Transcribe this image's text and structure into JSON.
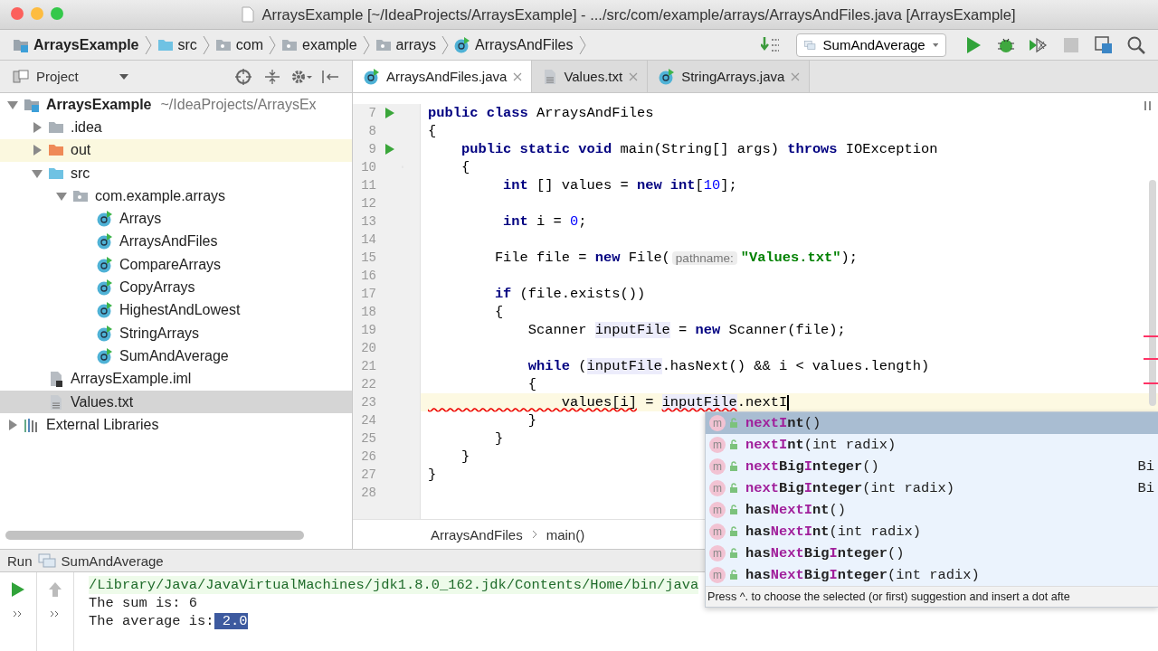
{
  "window": {
    "title": "ArraysExample [~/IdeaProjects/ArraysExample] - .../src/com/example/arrays/ArraysAndFiles.java [ArraysExample]"
  },
  "navbar": {
    "crumbs": [
      {
        "label": "ArraysExample",
        "kind": "project"
      },
      {
        "label": "src",
        "kind": "source-folder"
      },
      {
        "label": "com",
        "kind": "package"
      },
      {
        "label": "example",
        "kind": "package"
      },
      {
        "label": "arrays",
        "kind": "package"
      },
      {
        "label": "ArraysAndFiles",
        "kind": "class"
      }
    ],
    "run_config": "SumAndAverage",
    "stop_disabled": true
  },
  "project_panel": {
    "title": "Project",
    "tree": [
      {
        "label": "ArraysExample",
        "kind": "project",
        "path": "~/IdeaProjects/ArraysEx",
        "expanded": true,
        "selected": false,
        "children": [
          {
            "label": ".idea",
            "kind": "folder",
            "expanded": false,
            "selected": false
          },
          {
            "label": "out",
            "kind": "excluded-folder",
            "expanded": false,
            "selected": false
          },
          {
            "label": "src",
            "kind": "source-folder",
            "expanded": true,
            "selected": false,
            "children": [
              {
                "label": "com.example.arrays",
                "kind": "package",
                "expanded": true,
                "selected": false,
                "children": [
                  {
                    "label": "Arrays",
                    "kind": "class",
                    "selected": false
                  },
                  {
                    "label": "ArraysAndFiles",
                    "kind": "class",
                    "selected": false
                  },
                  {
                    "label": "CompareArrays",
                    "kind": "class",
                    "selected": false
                  },
                  {
                    "label": "CopyArrays",
                    "kind": "class",
                    "selected": false
                  },
                  {
                    "label": "HighestAndLowest",
                    "kind": "class",
                    "selected": false
                  },
                  {
                    "label": "StringArrays",
                    "kind": "class",
                    "selected": false
                  },
                  {
                    "label": "SumAndAverage",
                    "kind": "class",
                    "selected": false
                  }
                ]
              }
            ]
          },
          {
            "label": "ArraysExample.iml",
            "kind": "iml",
            "selected": false
          },
          {
            "label": "Values.txt",
            "kind": "text",
            "selected": true
          }
        ]
      },
      {
        "label": "External Libraries",
        "kind": "libraries",
        "expanded": false,
        "selected": false
      }
    ]
  },
  "tabs": [
    {
      "label": "ArraysAndFiles.java",
      "kind": "class",
      "selected": true
    },
    {
      "label": "Values.txt",
      "kind": "text",
      "selected": false
    },
    {
      "label": "StringArrays.java",
      "kind": "class",
      "selected": false
    }
  ],
  "editor": {
    "lines": [
      {
        "number": "7",
        "run": true,
        "tokens": [
          {
            "kind": "kw",
            "text": "public class"
          },
          {
            "kind": "plain",
            "text": " ArraysAndFiles"
          }
        ]
      },
      {
        "number": "8",
        "tokens": [
          {
            "kind": "plain",
            "text": "{"
          }
        ]
      },
      {
        "number": "9",
        "run": true,
        "tokens": [
          {
            "kind": "kw",
            "text": "    public static void"
          },
          {
            "kind": "plain",
            "text": " main(String[] args) "
          },
          {
            "kind": "kw",
            "text": "throws"
          },
          {
            "kind": "plain",
            "text": " IOException"
          }
        ]
      },
      {
        "number": "10",
        "fold": true,
        "tokens": [
          {
            "kind": "plain",
            "text": "    {"
          }
        ]
      },
      {
        "number": "11",
        "tokens": [
          {
            "kind": "kw",
            "text": "         int"
          },
          {
            "kind": "plain",
            "text": " [] values = "
          },
          {
            "kind": "kw",
            "text": "new int"
          },
          {
            "kind": "plain",
            "text": "["
          },
          {
            "kind": "num",
            "text": "10"
          },
          {
            "kind": "plain",
            "text": "];"
          }
        ]
      },
      {
        "number": "12"
      },
      {
        "number": "13",
        "tokens": [
          {
            "kind": "kw",
            "text": "         int"
          },
          {
            "kind": "plain",
            "text": " i = "
          },
          {
            "kind": "num",
            "text": "0"
          },
          {
            "kind": "plain",
            "text": ";"
          }
        ]
      },
      {
        "number": "14"
      },
      {
        "number": "15",
        "tokens": [
          {
            "kind": "plain",
            "text": "        File file = "
          },
          {
            "kind": "kw",
            "text": "new"
          },
          {
            "kind": "plain",
            "text": " File("
          },
          {
            "kind": "hint",
            "text": "pathname:"
          },
          {
            "kind": "str",
            "text": "\"Values.txt\""
          },
          {
            "kind": "plain",
            "text": ");"
          }
        ]
      },
      {
        "number": "16"
      },
      {
        "number": "17",
        "tokens": [
          {
            "kind": "kw",
            "text": "        if"
          },
          {
            "kind": "plain",
            "text": " (file.exists())"
          }
        ]
      },
      {
        "number": "18",
        "tokens": [
          {
            "kind": "plain",
            "text": "        {"
          }
        ]
      },
      {
        "number": "19",
        "tokens": [
          {
            "kind": "plain",
            "text": "            Scanner "
          },
          {
            "kind": "ref",
            "text": "inputFile"
          },
          {
            "kind": "plain",
            "text": " = "
          },
          {
            "kind": "kw",
            "text": "new"
          },
          {
            "kind": "plain",
            "text": " Scanner(file);"
          }
        ]
      },
      {
        "number": "20"
      },
      {
        "number": "21",
        "tokens": [
          {
            "kind": "kw",
            "text": "            while"
          },
          {
            "kind": "plain",
            "text": " ("
          },
          {
            "kind": "ref",
            "text": "inputFile"
          },
          {
            "kind": "plain",
            "text": ".hasNext() && i < values.length)"
          }
        ]
      },
      {
        "number": "22",
        "tokens": [
          {
            "kind": "plain",
            "text": "            {"
          }
        ]
      },
      {
        "number": "23",
        "current": true,
        "tokens": [
          {
            "kind": "error",
            "text": "                values[i]"
          },
          {
            "kind": "plain",
            "text": " = "
          },
          {
            "kind": "ref-error",
            "text": "inputFile"
          },
          {
            "kind": "plain",
            "text": ".nextI"
          }
        ]
      },
      {
        "number": "24",
        "tokens": [
          {
            "kind": "plain",
            "text": "            }"
          }
        ]
      },
      {
        "number": "25",
        "tokens": [
          {
            "kind": "plain",
            "text": "        }"
          }
        ]
      },
      {
        "number": "26",
        "tokens": [
          {
            "kind": "plain",
            "text": "    }"
          }
        ]
      },
      {
        "number": "27",
        "tokens": [
          {
            "kind": "plain",
            "text": "}"
          }
        ]
      },
      {
        "number": "28"
      }
    ],
    "breadcrumb": [
      "ArraysAndFiles",
      "main()"
    ]
  },
  "completion": {
    "items": [
      {
        "badge": "m",
        "parts": [
          {
            "text": "nextI",
            "match": true
          },
          {
            "text": "nt",
            "match": false
          }
        ],
        "params": "()",
        "selected": true
      },
      {
        "badge": "m",
        "parts": [
          {
            "text": "nextI",
            "match": true
          },
          {
            "text": "nt",
            "match": false
          }
        ],
        "params": "(int radix)",
        "selected": false
      },
      {
        "badge": "m",
        "parts": [
          {
            "text": "next",
            "match": true
          },
          {
            "text": "Big",
            "match": false
          },
          {
            "text": "I",
            "match": true
          },
          {
            "text": "nteger",
            "match": false
          }
        ],
        "params": "()",
        "type": "Bi",
        "selected": false
      },
      {
        "badge": "m",
        "parts": [
          {
            "text": "next",
            "match": true
          },
          {
            "text": "Big",
            "match": false
          },
          {
            "text": "I",
            "match": true
          },
          {
            "text": "nteger",
            "match": false
          }
        ],
        "params": "(int radix)",
        "type": "Bi",
        "selected": false
      },
      {
        "badge": "m",
        "parts": [
          {
            "text": "has",
            "match": false
          },
          {
            "text": "NextI",
            "match": true
          },
          {
            "text": "nt",
            "match": false
          }
        ],
        "params": "()",
        "selected": false
      },
      {
        "badge": "m",
        "parts": [
          {
            "text": "has",
            "match": false
          },
          {
            "text": "NextI",
            "match": true
          },
          {
            "text": "nt",
            "match": false
          }
        ],
        "params": "(int radix)",
        "selected": false
      },
      {
        "badge": "m",
        "parts": [
          {
            "text": "has",
            "match": false
          },
          {
            "text": "Next",
            "match": true
          },
          {
            "text": "Big",
            "match": false
          },
          {
            "text": "I",
            "match": true
          },
          {
            "text": "nteger",
            "match": false
          }
        ],
        "params": "()",
        "selected": false
      },
      {
        "badge": "m",
        "parts": [
          {
            "text": "has",
            "match": false
          },
          {
            "text": "Next",
            "match": true
          },
          {
            "text": "Big",
            "match": false
          },
          {
            "text": "I",
            "match": true
          },
          {
            "text": "nteger",
            "match": false
          }
        ],
        "params": "(int radix)",
        "selected": false
      }
    ],
    "footer": "Press ^. to choose the selected (or first) suggestion and insert a dot afte"
  },
  "run_panel": {
    "label": "Run",
    "config": "SumAndAverage",
    "lines": [
      {
        "kind": "command",
        "text": "/Library/Java/JavaVirtualMachines/jdk1.8.0_162.jdk/Contents/Home/bin/java"
      },
      {
        "kind": "output",
        "text": "The sum is: 6"
      },
      {
        "kind": "output",
        "text": "The average is:",
        "selection": " 2.0"
      }
    ]
  }
}
